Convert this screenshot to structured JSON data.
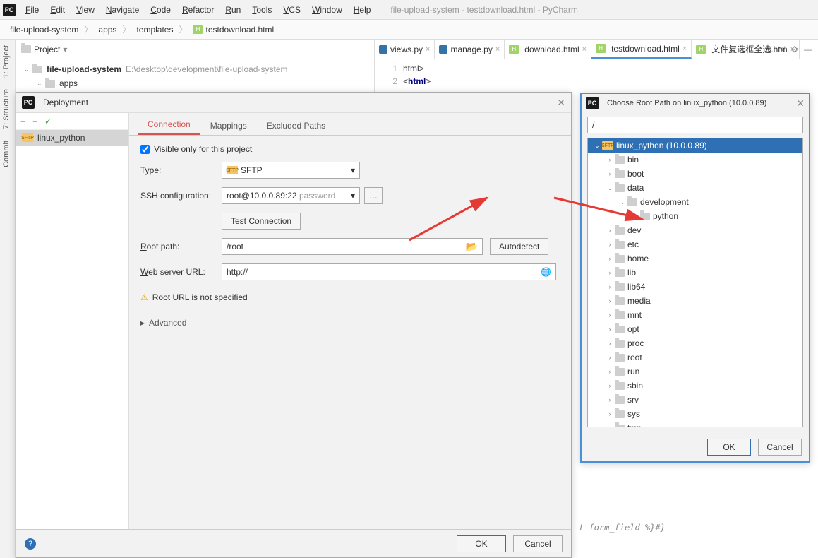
{
  "window": {
    "title_suffix": "file-upload-system - testdownload.html - PyCharm"
  },
  "menus": [
    "File",
    "Edit",
    "View",
    "Navigate",
    "Code",
    "Refactor",
    "Run",
    "Tools",
    "VCS",
    "Window",
    "Help"
  ],
  "breadcrumbs": [
    "file-upload-system",
    "apps",
    "templates",
    "testdownload.html"
  ],
  "project": {
    "label": "Project",
    "root": {
      "name": "file-upload-system",
      "path": "E:\\desktop\\development\\file-upload-system"
    },
    "child": "apps"
  },
  "editor_tabs": [
    {
      "name": "views.py",
      "type": "py"
    },
    {
      "name": "manage.py",
      "type": "py"
    },
    {
      "name": "download.html",
      "type": "html"
    },
    {
      "name": "testdownload.html",
      "type": "html",
      "active": true
    },
    {
      "name": "文件复选框全选.htm",
      "type": "html"
    }
  ],
  "editor_lines": [
    {
      "num": "1",
      "html": "<!DOCTYPE <span class='tag'>html</span>>"
    },
    {
      "num": "2",
      "html": "&lt;<span class='tag'>html</span>&gt;"
    }
  ],
  "deployment": {
    "title": "Deployment",
    "server_name": "linux_python",
    "tabs": [
      "Connection",
      "Mappings",
      "Excluded Paths"
    ],
    "visible_only": "Visible only for this project",
    "type_label": "Type:",
    "type_value": "SFTP",
    "ssh_label": "SSH configuration:",
    "ssh_value": "root@10.0.0.89:22",
    "ssh_hint": "password",
    "test_connection": "Test Connection",
    "root_path_label": "Root path:",
    "root_path_value": "/root",
    "autodetect": "Autodetect",
    "web_url_label": "Web server URL:",
    "web_url_value": "http://",
    "warning": "Root URL is not specified",
    "advanced": "Advanced",
    "ok": "OK",
    "cancel": "Cancel"
  },
  "root_dialog": {
    "title": "Choose Root Path on linux_python (10.0.0.89)",
    "path": "/",
    "root_node": "linux_python (10.0.0.89)",
    "nodes": [
      {
        "name": "bin",
        "depth": 1,
        "exp": "›"
      },
      {
        "name": "boot",
        "depth": 1,
        "exp": "›"
      },
      {
        "name": "data",
        "depth": 1,
        "exp": "⌄"
      },
      {
        "name": "development",
        "depth": 2,
        "exp": "⌄"
      },
      {
        "name": "python",
        "depth": 3,
        "exp": ""
      },
      {
        "name": "dev",
        "depth": 1,
        "exp": "›"
      },
      {
        "name": "etc",
        "depth": 1,
        "exp": "›"
      },
      {
        "name": "home",
        "depth": 1,
        "exp": "›"
      },
      {
        "name": "lib",
        "depth": 1,
        "exp": "›"
      },
      {
        "name": "lib64",
        "depth": 1,
        "exp": "›"
      },
      {
        "name": "media",
        "depth": 1,
        "exp": "›"
      },
      {
        "name": "mnt",
        "depth": 1,
        "exp": "›"
      },
      {
        "name": "opt",
        "depth": 1,
        "exp": "›"
      },
      {
        "name": "proc",
        "depth": 1,
        "exp": "›"
      },
      {
        "name": "root",
        "depth": 1,
        "exp": "›"
      },
      {
        "name": "run",
        "depth": 1,
        "exp": "›"
      },
      {
        "name": "sbin",
        "depth": 1,
        "exp": "›"
      },
      {
        "name": "srv",
        "depth": 1,
        "exp": "›"
      },
      {
        "name": "sys",
        "depth": 1,
        "exp": "›"
      },
      {
        "name": "tmp",
        "depth": 1,
        "exp": "›"
      }
    ],
    "ok": "OK",
    "cancel": "Cancel"
  },
  "sidebar_tools": [
    "1: Project",
    "7: Structure",
    "Commit"
  ],
  "code_snippet": "t form_field %}#}"
}
